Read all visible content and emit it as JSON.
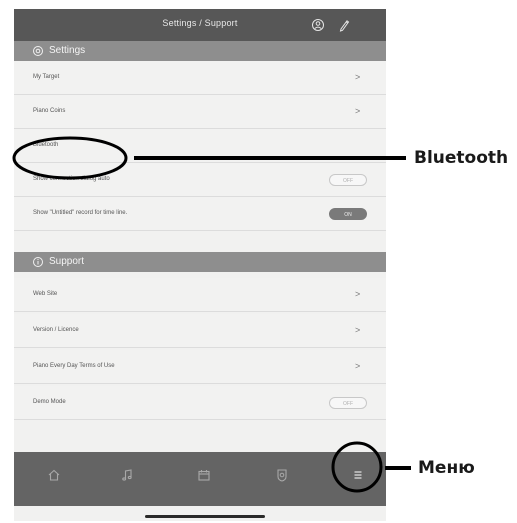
{
  "header": {
    "title": "Settings / Support",
    "icons": [
      "account-icon",
      "pen-icon"
    ]
  },
  "settings_section": {
    "title": "Settings",
    "icon": "gear-icon",
    "rows": [
      {
        "label": "My Target",
        "control": "chevron",
        "chevron": ">"
      },
      {
        "label": "Piano Coins",
        "control": "chevron",
        "chevron": ">"
      },
      {
        "label": "Bluetooth",
        "control": "none"
      },
      {
        "label": "Show connection dialog auto",
        "control": "toggle",
        "toggle": "OFF"
      },
      {
        "label": "Show \"Untitled\" record for time line.",
        "control": "toggle",
        "toggle": "ON"
      }
    ]
  },
  "support_section": {
    "title": "Support",
    "icon": "info-icon",
    "rows": [
      {
        "label": "Web Site",
        "control": "chevron",
        "chevron": ">"
      },
      {
        "label": "Version / Licence",
        "control": "chevron",
        "chevron": ">"
      },
      {
        "label": "Piano Every Day Terms of Use",
        "control": "chevron",
        "chevron": ">"
      },
      {
        "label": "Demo Mode",
        "control": "toggle",
        "toggle": "OFF"
      }
    ]
  },
  "bottom_nav": {
    "items": [
      "home-icon",
      "music-note-icon",
      "calendar-icon",
      "badge-icon",
      "menu-icon"
    ]
  },
  "annotations": {
    "bluetooth": "Bluetooth",
    "menu": "Меню"
  },
  "colors": {
    "header": "#575757",
    "section": "#8e8e8e",
    "background": "#f1f1f0",
    "bottom_bar": "#646464",
    "toggle_on": "#7a7a7a"
  }
}
